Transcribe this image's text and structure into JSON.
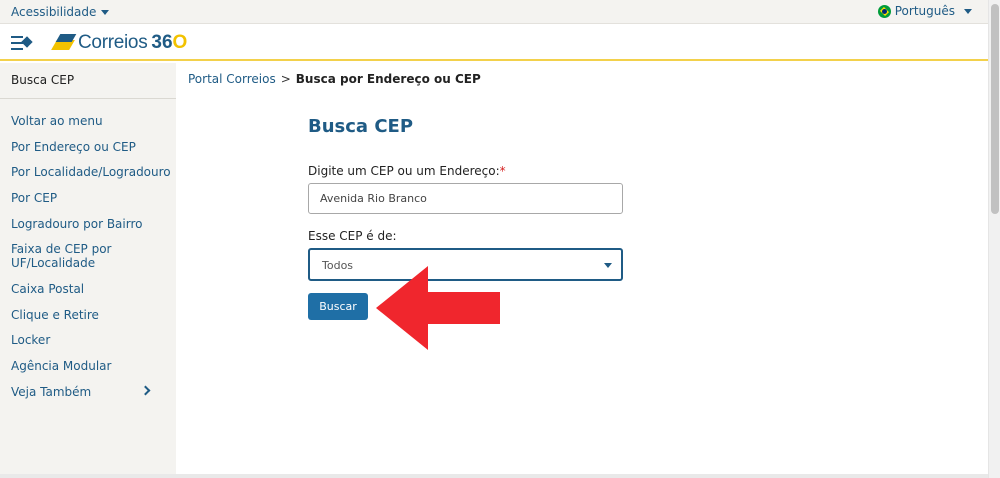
{
  "topbar": {
    "accessibility": "Acessibilidade",
    "language": "Português"
  },
  "header": {
    "logo_text": "Correios",
    "logo_number": "36",
    "logo_number_o": "O"
  },
  "sidebar": {
    "title": "Busca CEP",
    "items": [
      {
        "label": "Voltar ao menu"
      },
      {
        "label": "Por Endereço ou CEP"
      },
      {
        "label": "Por Localidade/Logradouro"
      },
      {
        "label": "Por CEP"
      },
      {
        "label": "Logradouro por Bairro"
      },
      {
        "label": "Faixa de CEP por"
      },
      {
        "label": "UF/Localidade"
      },
      {
        "label": "Caixa Postal"
      },
      {
        "label": "Clique e Retire"
      },
      {
        "label": "Locker"
      },
      {
        "label": "Agência Modular"
      },
      {
        "label": "Veja Também"
      }
    ]
  },
  "breadcrumb": {
    "home": "Portal Correios",
    "separator": ">",
    "current": "Busca por Endereço ou CEP"
  },
  "form": {
    "title": "Busca CEP",
    "cep_label": "Digite um CEP ou um Endereço:",
    "required_mark": "*",
    "cep_value": "Avenida Rio Branco",
    "type_label": "Esse CEP é de:",
    "type_value": "Todos",
    "submit_label": "Buscar"
  },
  "colors": {
    "brand_blue": "#1f5b85",
    "brand_yellow": "#f2c200",
    "button_blue": "#1f6fa6",
    "annotation_red": "#f0262d"
  }
}
